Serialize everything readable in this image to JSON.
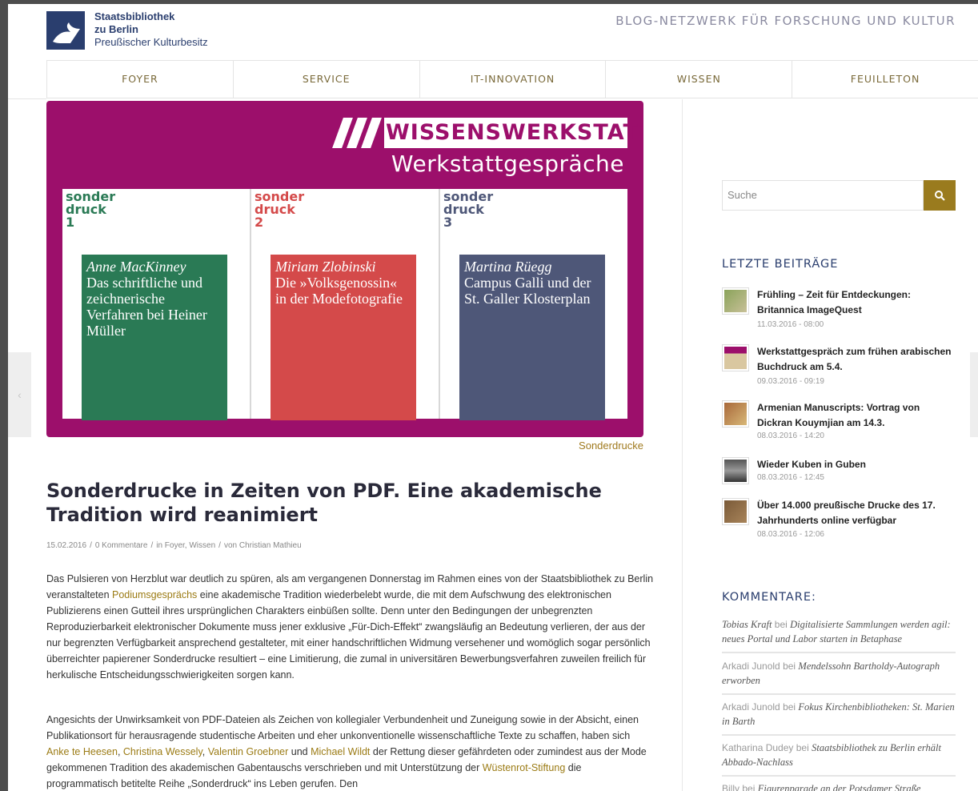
{
  "header": {
    "logo_line1": "Staatsbibliothek",
    "logo_line2": "zu Berlin",
    "logo_line3": "Preußischer Kulturbesitz",
    "tagline": "BLOG-NETZWERK FÜR FORSCHUNG UND KULTUR"
  },
  "nav": [
    "FOYER",
    "SERVICE",
    "IT-INNOVATION",
    "WISSEN",
    "FEUILLETON"
  ],
  "hero": {
    "brand": "WISSENSWERKSTATT",
    "subtitle": "Werkstattgespräche",
    "panels": [
      {
        "l1": "sonder",
        "l2": "druck",
        "num": "1",
        "author": "Anne MacKinney",
        "title": "Das schriftliche und zeichnerische Verfahren bei Heiner Müller",
        "color": "#2a7a55"
      },
      {
        "l1": "sonder",
        "l2": "druck",
        "num": "2",
        "author": "Miriam Zlobinski",
        "title": "Die »Volksgenossin« in der Modefotografie",
        "color": "#d44a4a"
      },
      {
        "l1": "sonder",
        "l2": "druck",
        "num": "3",
        "author": "Martina Rüegg",
        "title": "Campus Galli und der St. Galler Klosterplan",
        "color": "#4e5778"
      }
    ],
    "caption": "Sonderdrucke"
  },
  "article": {
    "title": "Sonderdrucke in Zeiten von PDF. Eine akademische Tradition wird reanimiert",
    "date": "15.02.2016",
    "comments": "0 Kommentare",
    "in_label": "in",
    "cats": "Foyer, Wissen",
    "by_label": "von",
    "author": "Christian Mathieu",
    "p1_before": "Das Pulsieren von Herzblut war deutlich zu spüren, als am vergangenen Donnerstag im Rahmen eines von der Staatsbibliothek zu Berlin veranstalteten ",
    "p1_link": "Podiumsgesprächs",
    "p1_after": " eine akademische Tradition wiederbelebt wurde, die mit dem Aufschwung des elektronischen Publizierens einen Gutteil ihres ursprünglichen Charakters einbüßen sollte. Denn unter den Bedingungen der unbegrenzten Reproduzierbarkeit elektronischer Dokumente muss jener exklusive „Für-Dich-Effekt“ zwangsläufig an Bedeutung verlieren, der aus der nur begrenzten Verfügbarkeit ansprechend gestalteter, mit einer handschriftlichen Widmung versehener und womöglich sogar persönlich überreichter papierener Sonderdrucke resultiert – eine Limitierung, die zumal in universitären Bewerbungsverfahren zuweilen freilich für herkulische Entscheidungsschwierigkeiten sorgen kann.",
    "p2_a": "Angesichts der Unwirksamkeit von PDF-Dateien als Zeichen von kollegialer Verbundenheit und Zuneigung sowie in der Absicht, einen Publikationsort für herausragende studentische Arbeiten und eher unkonventionelle wissenschaftliche Texte zu schaffen, haben sich ",
    "p2_l1": "Anke te Heesen",
    "p2_s1": ", ",
    "p2_l2": "Christina Wessely",
    "p2_s2": ", ",
    "p2_l3": "Valentin Groebner",
    "p2_s3": " und ",
    "p2_l4": "Michael Wildt",
    "p2_b": " der Rettung dieser gefährdeten oder zumindest aus der Mode gekommenen Tradition des akademischen Gabentauschs verschrieben und mit Unterstützung der ",
    "p2_l5": "Wüstenrot-Stiftung",
    "p2_c": " die programmatisch betitelte Reihe „Sonderdruck“ ins Leben gerufen. Den"
  },
  "sidebar": {
    "search_placeholder": "Suche",
    "recent_title": "LETZTE BEITRÄGE",
    "posts": [
      {
        "title": "Frühling – Zeit für Entdeckungen: Britannica ImageQuest",
        "date": "11.03.2016 - 08:00"
      },
      {
        "title": "Werkstattgespräch zum frühen arabischen Buchdruck am 5.4.",
        "date": "09.03.2016 - 09:19"
      },
      {
        "title": "Armenian Manuscripts: Vortrag von Dickran Kouymjian am 14.3.",
        "date": "08.03.2016 - 14:20"
      },
      {
        "title": "Wieder Kuben in Guben",
        "date": "08.03.2016 - 12:45"
      },
      {
        "title": "Über 14.000 preußische Drucke des 17. Jahrhunderts online verfügbar",
        "date": "08.03.2016 - 12:06"
      }
    ],
    "comments_title": "KOMMENTARE:",
    "by_label": "bei",
    "comments": [
      {
        "who": "Tobias Kraft",
        "target": "Digitalisierte Sammlungen werden agil: neues Portal und Labor starten in Betaphase"
      },
      {
        "who": "Arkadi Junold",
        "target": "Mendelssohn Bartholdy-Autograph erworben"
      },
      {
        "who": "Arkadi Junold",
        "target": "Fokus Kirchenbibliotheken: St. Marien in Barth"
      },
      {
        "who": "Katharina Dudey",
        "target": "Staatsbibliothek zu Berlin erhält Abbado-Nachlass"
      },
      {
        "who": "Billy",
        "target": "Figurenparade an der Potsdamer Straße"
      }
    ]
  },
  "colors": {
    "accent": "#9a7b1e",
    "brand_magenta": "#9c0f6b",
    "brand_blue": "#2a3e6e"
  }
}
